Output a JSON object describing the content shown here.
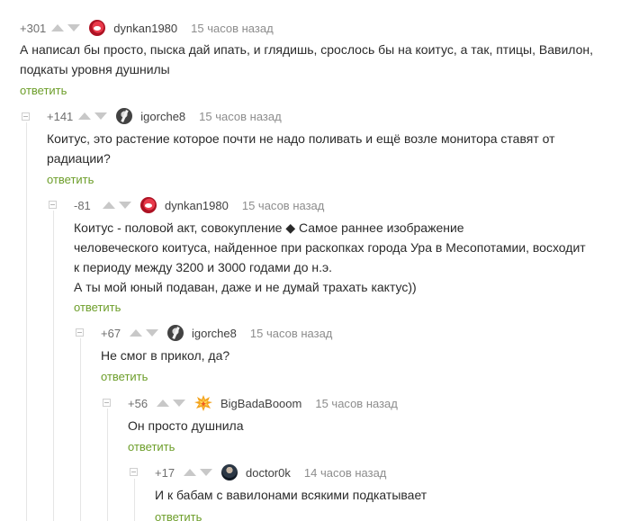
{
  "comments": [
    {
      "rating": "+301",
      "author": "dynkan1980",
      "time": "15 часов назад",
      "text": "А написал бы просто, пыска дай ипать, и глядишь, срослось бы на коитус, а так, птицы, Вавилон,\nподкаты уровня душнилы",
      "reply": "ответить",
      "avatar_icon": "red-user-avatar-icon"
    },
    {
      "rating": "+141",
      "author": "igorche8",
      "time": "15 часов назад",
      "text": "Коитус, это растение которое почти не надо поливать и ещё возле монитора ставят от\nрадиации?",
      "reply": "ответить",
      "avatar_icon": "black-white-user-avatar-icon"
    },
    {
      "rating": "-81",
      "author": "dynkan1980",
      "time": "15 часов назад",
      "text": "Коитус - половой акт, совокупление ◆ Самое раннее изображение\nчеловеческого коитуса, найденное при раскопках города Ура в Месопотамии, восходит\nк периоду между 3200 и 3000 годами до н.э.\nА ты мой юный подаван, даже и не думай трахать кактус))",
      "reply": "ответить",
      "avatar_icon": "red-user-avatar-icon"
    },
    {
      "rating": "+67",
      "author": "igorche8",
      "time": "15 часов назад",
      "text": "Не смог в прикол, да?",
      "reply": "ответить",
      "avatar_icon": "black-white-user-avatar-icon"
    },
    {
      "rating": "+56",
      "author": "BigBadaBooom",
      "time": "15 часов назад",
      "text": "Он просто душнила",
      "reply": "ответить",
      "avatar_icon": "explosion-avatar-icon"
    },
    {
      "rating": "+17",
      "author": "doctor0k",
      "time": "14 часов назад",
      "text": "И к бабам с вавилонами всякими подкатывает",
      "reply": "ответить",
      "avatar_icon": "doctor-avatar-icon"
    }
  ],
  "colors": {
    "reply_link": "#6d9e2a",
    "meta_text": "#8b8b8b",
    "body_text": "#2a2a2a"
  }
}
